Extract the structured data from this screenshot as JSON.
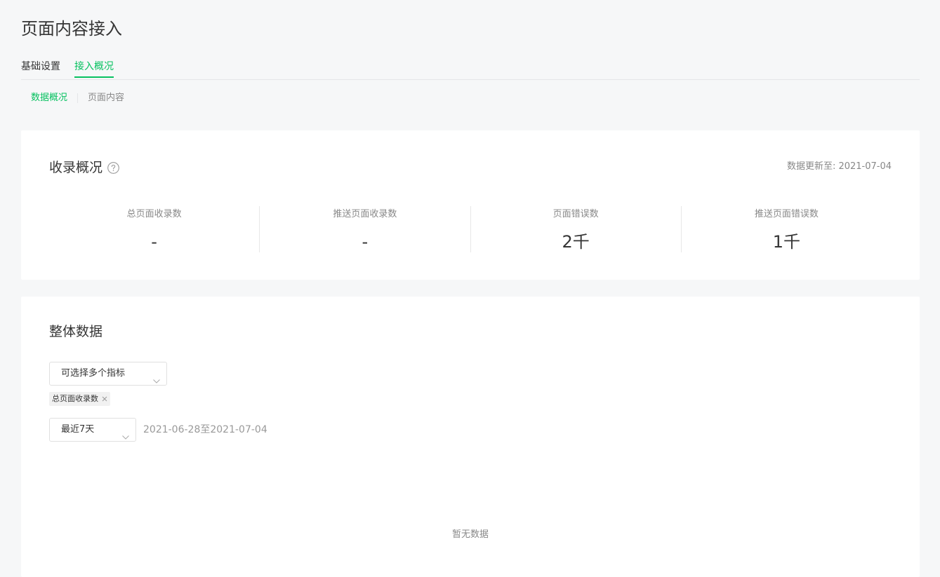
{
  "page": {
    "title": "页面内容接入"
  },
  "main_tabs": [
    {
      "label": "基础设置",
      "active": false
    },
    {
      "label": "接入概况",
      "active": true
    }
  ],
  "sub_tabs": [
    {
      "label": "数据概况",
      "active": true
    },
    {
      "label": "页面内容",
      "active": false
    }
  ],
  "overview": {
    "title": "收录概况",
    "update_label": "数据更新至:",
    "update_date": "2021-07-04",
    "stats": [
      {
        "label": "总页面收录数",
        "value": "-"
      },
      {
        "label": "推送页面收录数",
        "value": "-"
      },
      {
        "label": "页面错误数",
        "value": "2千"
      },
      {
        "label": "推送页面错误数",
        "value": "1千"
      }
    ]
  },
  "overall": {
    "title": "整体数据",
    "metric_select": {
      "placeholder": "可选择多个指标"
    },
    "selected_tags": [
      "总页面收录数"
    ],
    "range_select": {
      "value": "最近7天"
    },
    "date_range": "2021-06-28至2021-07-04",
    "empty_text": "暂无数据"
  },
  "colors": {
    "accent": "#07c160",
    "background": "#f6f7f8",
    "text": "#353535",
    "muted": "#888888"
  }
}
